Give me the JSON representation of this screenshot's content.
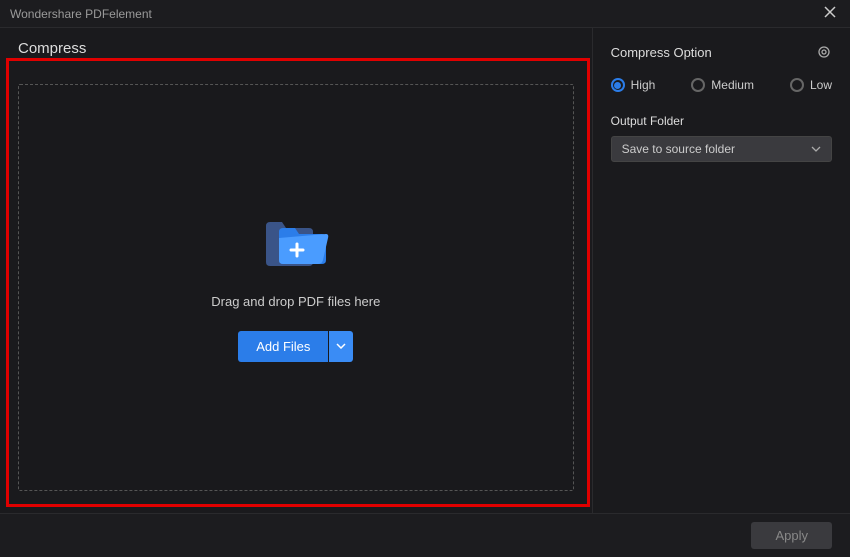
{
  "app": {
    "title": "Wondershare PDFelement"
  },
  "section": {
    "heading": "Compress"
  },
  "dropzone": {
    "hint": "Drag and drop PDF files here",
    "addButton": "Add Files"
  },
  "options": {
    "title": "Compress Option",
    "levels": {
      "high": "High",
      "medium": "Medium",
      "low": "Low"
    },
    "selected": "high",
    "outputFolderLabel": "Output Folder",
    "outputFolderValue": "Save to source folder"
  },
  "footer": {
    "apply": "Apply"
  }
}
